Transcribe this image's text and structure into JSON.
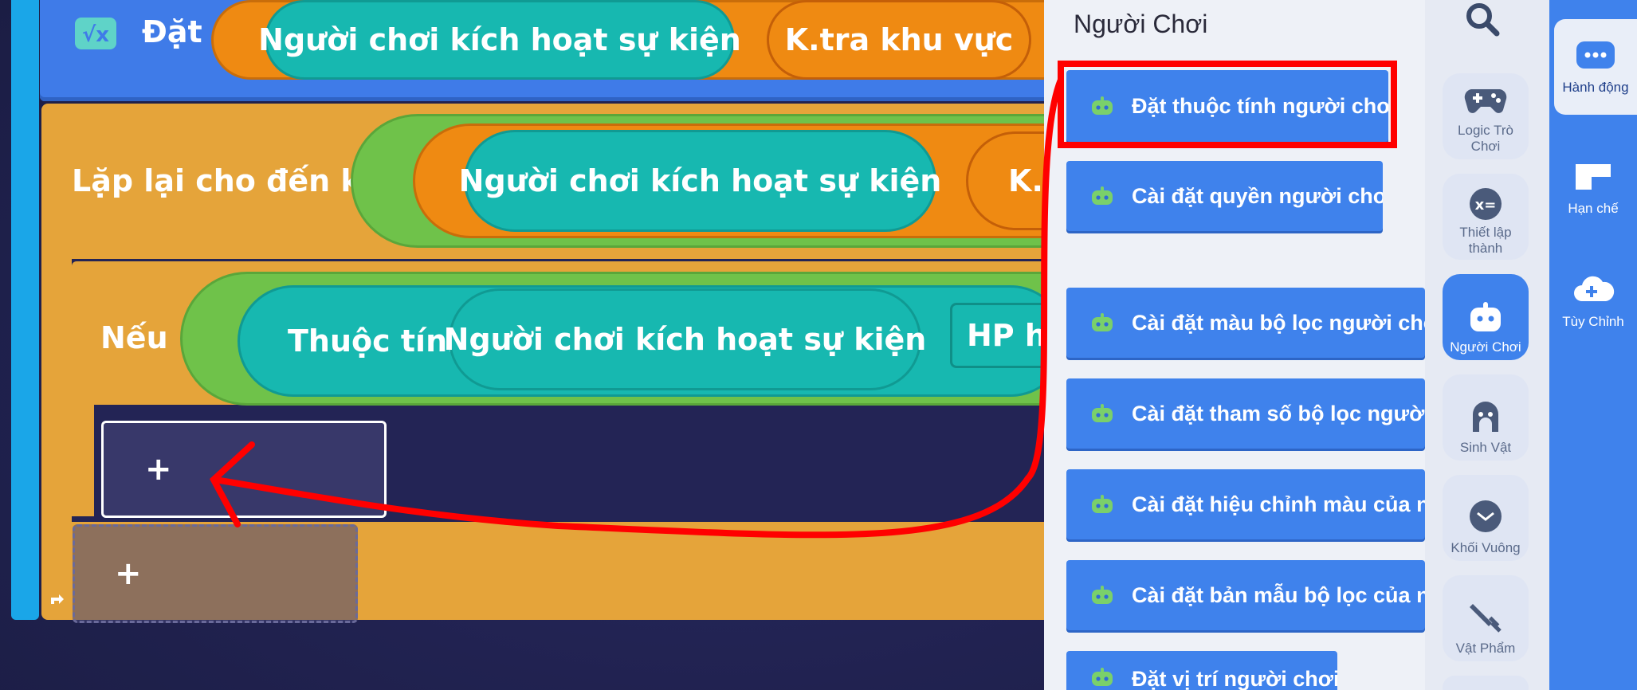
{
  "workspace": {
    "set_block": {
      "label": "Đặt",
      "arg1": "Người chơi kích hoạt sự kiện",
      "arg2": "K.tra khu vực"
    },
    "repeat_block": {
      "label": "Lặp lại cho đến khi",
      "arg1": "Người chơi kích hoạt sự kiện",
      "arg2": "K.t"
    },
    "if_block": {
      "label": "Nếu",
      "attr_label": "Thuộc tính",
      "arg1": "Người chơi kích hoạt sự kiện",
      "arg2": "HP hiệ"
    },
    "slot_plus_1": "+",
    "slot_plus_2": "+"
  },
  "palette": {
    "title": "Người Chơi",
    "items": [
      {
        "label": "Đặt thuộc tính người chơi"
      },
      {
        "label": "Cài đặt quyền người chơi"
      },
      {
        "label": "Cài đặt màu bộ lọc người chơi"
      },
      {
        "label": "Cài đặt tham số bộ lọc người chơi"
      },
      {
        "label": "Cài đặt hiệu chỉnh màu của người"
      },
      {
        "label": "Cài đặt bản mẫu bộ lọc của người"
      },
      {
        "label": "Đặt vị trí người chơi"
      }
    ]
  },
  "categories": {
    "search_icon": "search-icon",
    "items": [
      {
        "label": "Logic Trò Chơi",
        "icon": "gamepad-icon"
      },
      {
        "label": "Thiết lập thành",
        "icon": "variable-icon"
      },
      {
        "label": "Người Chơi",
        "icon": "robot-icon",
        "active": true
      },
      {
        "label": "Sinh Vật",
        "icon": "creature-icon"
      },
      {
        "label": "Khối Vuông",
        "icon": "cube-icon"
      },
      {
        "label": "Vật Phẩm",
        "icon": "sword-icon"
      }
    ]
  },
  "actions": {
    "items": [
      {
        "label": "Hành động",
        "icon": "chat-icon",
        "active": true
      },
      {
        "label": "Hạn chế",
        "icon": "restrict-icon"
      },
      {
        "label": "Tùy Chỉnh",
        "icon": "cloud-plus-icon"
      }
    ]
  },
  "colors": {
    "palette_button": "#3f82ec",
    "teal_pill": "#17b8b0",
    "orange_block": "#ef8a12",
    "yellow_loop": "#e5a43a",
    "green_condition": "#6fc24a",
    "annotation_red": "#ff0000"
  }
}
